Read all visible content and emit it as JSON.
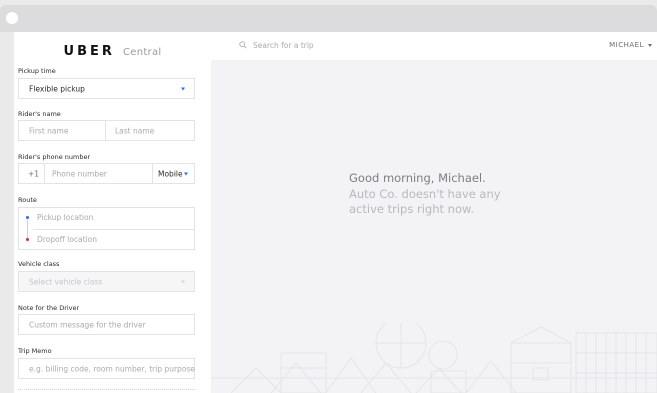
{
  "app": {
    "brand": "UBER",
    "brand_sub": "Central"
  },
  "form": {
    "pickup_time": {
      "label": "Pickup time",
      "value": "Flexible pickup"
    },
    "riders_name": {
      "label": "Rider's name",
      "first_placeholder": "First name",
      "last_placeholder": "Last name"
    },
    "phone": {
      "label": "Rider's phone number",
      "country_code": "+1",
      "placeholder": "Phone number",
      "type": "Mobile"
    },
    "route": {
      "label": "Route",
      "pickup_placeholder": "Pickup location",
      "dropoff_placeholder": "Dropoff location"
    },
    "vehicle_class": {
      "label": "Vehicle class",
      "placeholder": "Select vehicle class"
    },
    "note": {
      "label": "Note for the Driver",
      "placeholder": "Custom message for the driver"
    },
    "trip_memo": {
      "label": "Trip Memo",
      "placeholder": "e.g. billing code, room number, trip purpose"
    }
  },
  "topbar": {
    "search_placeholder": "Search for a trip",
    "user_name": "MICHAEL"
  },
  "main": {
    "greeting": "Good morning, Michael.",
    "message_line1": "Auto Co. doesn't have any",
    "message_line2": "active trips right now."
  },
  "colors": {
    "accent": "#276ef1",
    "pickup_dot": "#276ef1",
    "dropoff_dot": "#d0302a"
  },
  "icons": {
    "search": "search-icon",
    "chevron": "chevron-down-icon"
  }
}
